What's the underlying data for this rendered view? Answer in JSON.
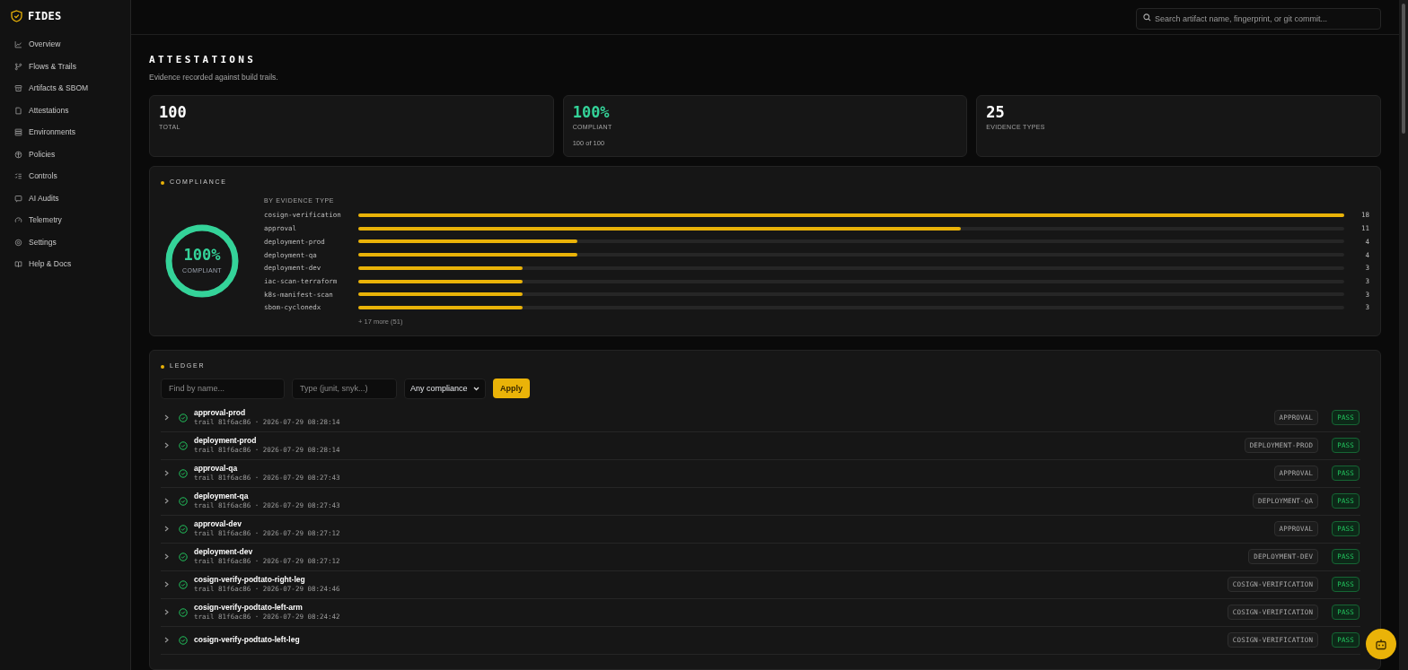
{
  "brand": {
    "name": "FIDES"
  },
  "sidebar": {
    "items": [
      {
        "label": "Overview",
        "selected": false
      },
      {
        "label": "Flows & Trails",
        "selected": false
      },
      {
        "label": "Artifacts & SBOM",
        "selected": false
      },
      {
        "label": "Attestations",
        "selected": false
      },
      {
        "label": "Environments",
        "selected": false
      },
      {
        "label": "Policies",
        "selected": false
      },
      {
        "label": "Controls",
        "selected": false
      },
      {
        "label": "AI Audits",
        "selected": false
      },
      {
        "label": "Telemetry",
        "selected": false
      },
      {
        "label": "Settings",
        "selected": false
      },
      {
        "label": "Help & Docs",
        "selected": false
      }
    ]
  },
  "search": {
    "placeholder": "Search artifact name, fingerprint, or git commit..."
  },
  "page": {
    "title": "ATTESTATIONS",
    "subtitle": "Evidence recorded against build trails."
  },
  "stats": [
    {
      "value": "100",
      "label": "TOTAL",
      "kind": "plain"
    },
    {
      "value": "100%",
      "label": "COMPLIANT",
      "note": "100 of 100",
      "kind": "good"
    },
    {
      "value": "25",
      "label": "EVIDENCE TYPES",
      "kind": "plain"
    }
  ],
  "compliance": {
    "title": "COMPLIANCE",
    "donut": {
      "value": "100%",
      "label": "COMPLIANT",
      "level": 1
    },
    "subtitle": "BY EVIDENCE TYPE",
    "bars": [
      {
        "name": "cosign-verification",
        "count": "18",
        "level": 1
      },
      {
        "name": "approval",
        "count": "11",
        "level": 0.611
      },
      {
        "name": "deployment-prod",
        "count": "4",
        "level": 0.222
      },
      {
        "name": "deployment-qa",
        "count": "4",
        "level": 0.222
      },
      {
        "name": "deployment-dev",
        "count": "3",
        "level": 0.167
      },
      {
        "name": "iac-scan-terraform",
        "count": "3",
        "level": 0.167
      },
      {
        "name": "k8s-manifest-scan",
        "count": "3",
        "level": 0.167
      },
      {
        "name": "sbom-cyclonedx",
        "count": "3",
        "level": 0.167
      }
    ],
    "more": "+ 17 more (51)"
  },
  "ledger": {
    "title": "LEDGER",
    "name_filter": {
      "placeholder": "Find by name..."
    },
    "type_filter": {
      "placeholder": "Type (junit, snyk...)"
    },
    "compliance_select": {
      "value": "Any compliance"
    },
    "apply_button": "Apply",
    "rows": [
      {
        "name": "approval-prod",
        "meta": "trail 81f6ac86 · 2026-07-29 08:28:14",
        "type": "APPROVAL",
        "status": "PASS",
        "kind": "pass"
      },
      {
        "name": "deployment-prod",
        "meta": "trail 81f6ac86 · 2026-07-29 08:28:14",
        "type": "DEPLOYMENT-PROD",
        "status": "PASS",
        "kind": "pass"
      },
      {
        "name": "approval-qa",
        "meta": "trail 81f6ac86 · 2026-07-29 08:27:43",
        "type": "APPROVAL",
        "status": "PASS",
        "kind": "pass"
      },
      {
        "name": "deployment-qa",
        "meta": "trail 81f6ac86 · 2026-07-29 08:27:43",
        "type": "DEPLOYMENT-QA",
        "status": "PASS",
        "kind": "pass"
      },
      {
        "name": "approval-dev",
        "meta": "trail 81f6ac86 · 2026-07-29 08:27:12",
        "type": "APPROVAL",
        "status": "PASS",
        "kind": "pass"
      },
      {
        "name": "deployment-dev",
        "meta": "trail 81f6ac86 · 2026-07-29 08:27:12",
        "type": "DEPLOYMENT-DEV",
        "status": "PASS",
        "kind": "pass"
      },
      {
        "name": "cosign-verify-podtato-right-leg",
        "meta": "trail 81f6ac86 · 2026-07-29 08:24:46",
        "type": "COSIGN-VERIFICATION",
        "status": "PASS",
        "kind": "pass"
      },
      {
        "name": "cosign-verify-podtato-left-arm",
        "meta": "trail 81f6ac86 · 2026-07-29 08:24:42",
        "type": "COSIGN-VERIFICATION",
        "status": "PASS",
        "kind": "pass"
      },
      {
        "name": "cosign-verify-podtato-left-leg",
        "type": "COSIGN-VERIFICATION",
        "status": "PASS",
        "kind": "pass"
      }
    ]
  }
}
